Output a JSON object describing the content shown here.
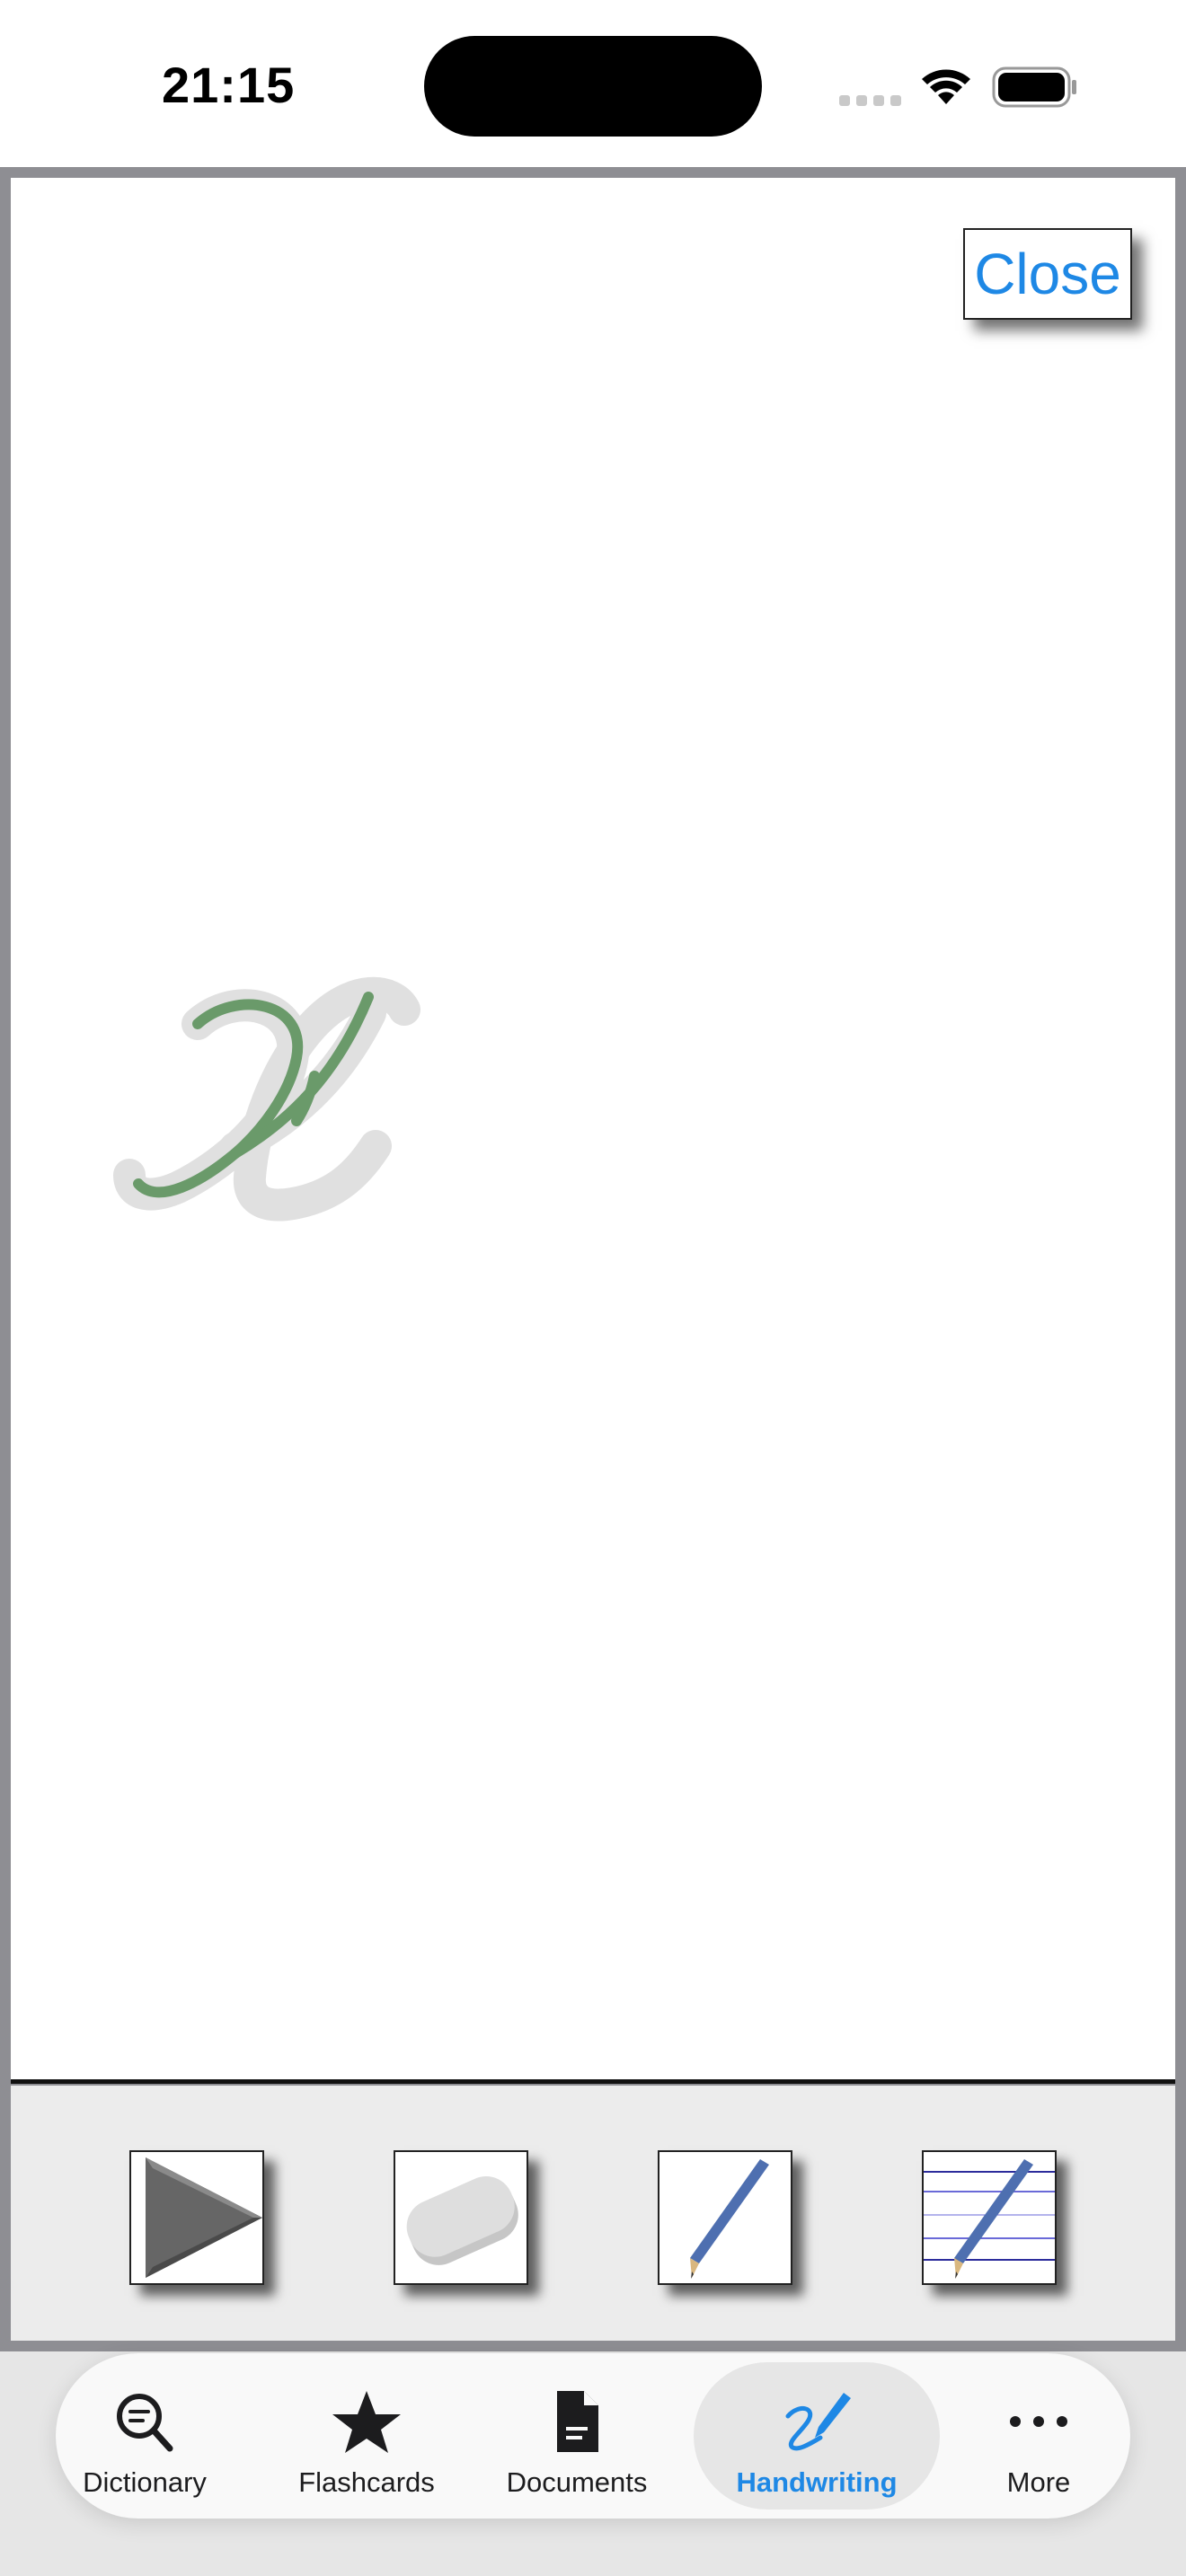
{
  "status_bar": {
    "time": "21:15",
    "icons": [
      "cellular-signal-icon",
      "wifi-icon",
      "battery-icon"
    ]
  },
  "canvas": {
    "close_label": "Close",
    "practice_letter_icon": "cursive-letter-zh",
    "guide_color": "#e0e0e0",
    "stroke_color": "#6a9a6a"
  },
  "toolbar": {
    "tools": [
      {
        "name": "play",
        "icon": "play-icon"
      },
      {
        "name": "eraser",
        "icon": "eraser-icon"
      },
      {
        "name": "pencil",
        "icon": "pencil-icon"
      },
      {
        "name": "lined-paper-pencil",
        "icon": "lined-paper-pencil-icon"
      }
    ]
  },
  "tab_bar": {
    "tabs": [
      {
        "label": "Dictionary",
        "icon": "search-icon"
      },
      {
        "label": "Flashcards",
        "icon": "star-icon"
      },
      {
        "label": "Documents",
        "icon": "document-icon"
      },
      {
        "label": "Handwriting",
        "icon": "handwriting-icon",
        "active": true
      },
      {
        "label": "More",
        "icon": "more-icon"
      }
    ]
  },
  "colors": {
    "accent": "#1e88e5",
    "frame": "#8e8e93",
    "toolbar_bg": "#ececec"
  }
}
